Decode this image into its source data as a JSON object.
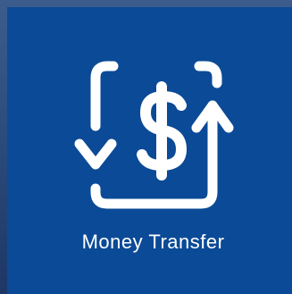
{
  "tile": {
    "label": "Money Transfer",
    "icon": "money-transfer-icon",
    "background_color": "#0b4a96",
    "foreground_color": "#ffffff"
  }
}
